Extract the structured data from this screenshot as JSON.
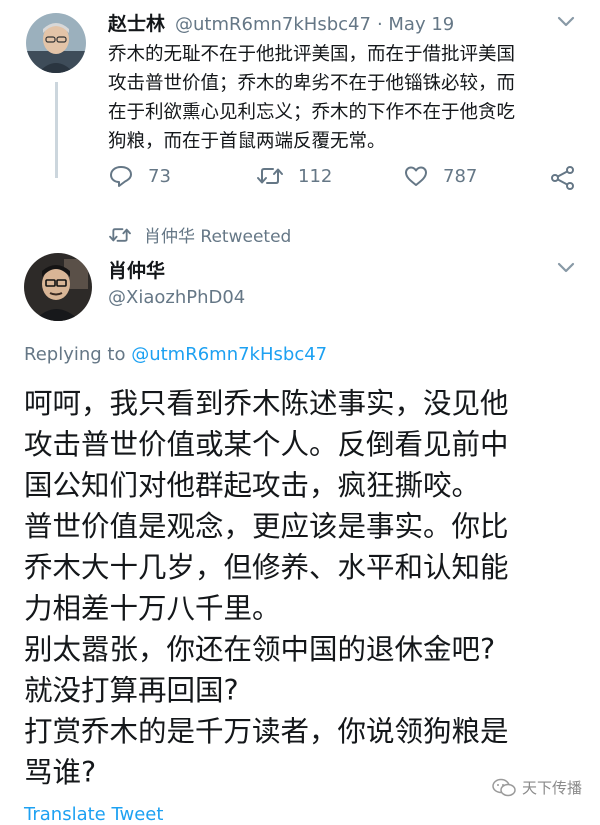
{
  "tweet1": {
    "author_name": "赵士林",
    "author_handle": "@utmR6mn7kHsbc47",
    "date": "· May 19",
    "text_lines": [
      "乔木的无耻不在于他批评美国，而在于借批评美国",
      "攻击普世价值；乔木的卑劣不在于他锱铢必较，而",
      "在于利欲熏心见利忘义；乔木的下作不在于他贪吃",
      "狗粮，而在于首鼠两端反覆无常。"
    ],
    "reply_count": "73",
    "retweet_count": "112",
    "like_count": "787"
  },
  "retweet_banner": {
    "text": "肖仲华 Retweeted"
  },
  "tweet2": {
    "author_name": "肖仲华",
    "author_handle": "@XiaozhPhD04",
    "replying_prefix": "Replying to ",
    "replying_handle": "@utmR6mn7kHsbc47",
    "text_lines": [
      "呵呵，我只看到乔木陈述事实，没见他",
      "攻击普世价值或某个人。反倒看见前中",
      "国公知们对他群起攻击，疯狂撕咬。",
      "普世价值是观念，更应该是事实。你比",
      "乔木大十几岁，但修养、水平和认知能",
      "力相差十万八千里。",
      "别太嚣张，你还在领中国的退休金吧?",
      "就没打算再回国?",
      "打赏乔木的是千万读者，你说领狗粮是",
      "骂谁?"
    ],
    "translate_label": "Translate Tweet"
  },
  "watermark": {
    "text": "天下传播"
  },
  "icons": [
    "chevron-down-icon",
    "reply-icon",
    "retweet-icon",
    "like-icon",
    "share-icon",
    "wechat-icon"
  ],
  "colors": {
    "link": "#1da1f2",
    "muted": "#657786",
    "text": "#14171a"
  }
}
